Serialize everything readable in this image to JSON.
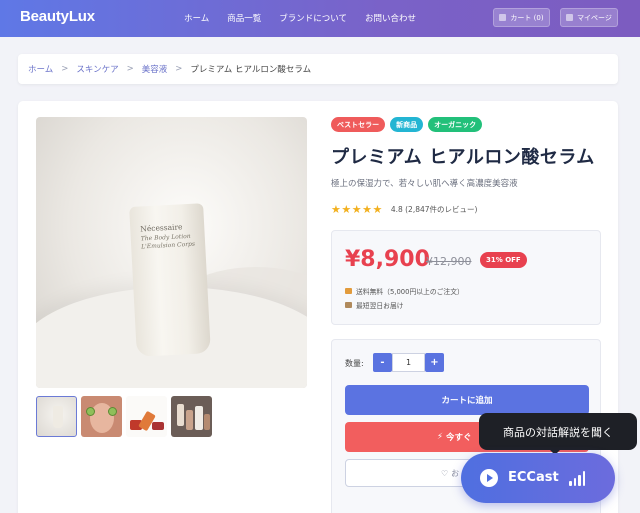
{
  "header": {
    "logo": "BeautyLux",
    "nav": [
      "ホーム",
      "商品一覧",
      "ブランドについて",
      "お問い合わせ"
    ],
    "cart_label": "カート (0)",
    "mypage_label": "マイページ"
  },
  "breadcrumb": {
    "items": [
      "ホーム",
      "スキンケア",
      "美容液"
    ],
    "separator": ">",
    "current": "プレミアム ヒアルロン酸セラム"
  },
  "product": {
    "image_text": {
      "brand": "Nécessaire",
      "line1": "The Body Lotion",
      "line2": "L'Emulsion Corps"
    },
    "badges": [
      "ベストセラー",
      "新商品",
      "オーガニック"
    ],
    "title": "プレミアム ヒアルロン酸セラム",
    "subtitle": "極上の保湿力で、若々しい肌へ導く高濃度美容液",
    "rating_stars": "★★★★★",
    "rating_text": "4.8 (2,847件のレビュー)",
    "price": "¥8,900",
    "old_price": "¥12,900",
    "discount": "31% OFF",
    "shipping": "送料無料（5,000円以上のご注文）",
    "delivery": "最短翌日お届け",
    "qty_label": "数量:",
    "qty_minus": "-",
    "qty_value": "1",
    "qty_plus": "+",
    "add_to_cart": "カートに追加",
    "buy_now": "今すぐ",
    "buy_now_icon": "⚡",
    "favorite": "お",
    "favorite_icon": "♡"
  },
  "widget": {
    "tooltip": "商品の対話解説を聞く",
    "label": "ECCast"
  },
  "colors": {
    "header_start": "#5f78e6",
    "header_end": "#7c5cc0",
    "price": "#e8414f",
    "primary_button": "#5b73e1",
    "buy_button": "#f25e5e"
  }
}
